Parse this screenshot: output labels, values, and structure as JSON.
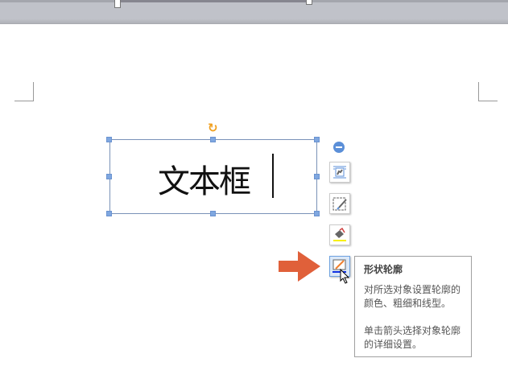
{
  "textbox": {
    "content": "文本框"
  },
  "side_toolbar": {
    "buttons": [
      {
        "name": "collapse",
        "icon": "minus-circle-icon"
      },
      {
        "name": "layout-options",
        "icon": "text-wrap-icon"
      },
      {
        "name": "shape-style",
        "icon": "shape-edit-icon"
      },
      {
        "name": "shape-fill",
        "icon": "paint-bucket-icon"
      },
      {
        "name": "shape-outline",
        "icon": "outline-pen-icon"
      }
    ]
  },
  "tooltip": {
    "title": "形状轮廓",
    "line1": "对所选对象设置轮廓的颜色、粗细和线型。",
    "line2": "单击箭头选择对象轮廓的详细设置。"
  },
  "colors": {
    "accent": "#5b8fd8",
    "arrow": "#e0603a",
    "rotate": "#f0a020"
  }
}
